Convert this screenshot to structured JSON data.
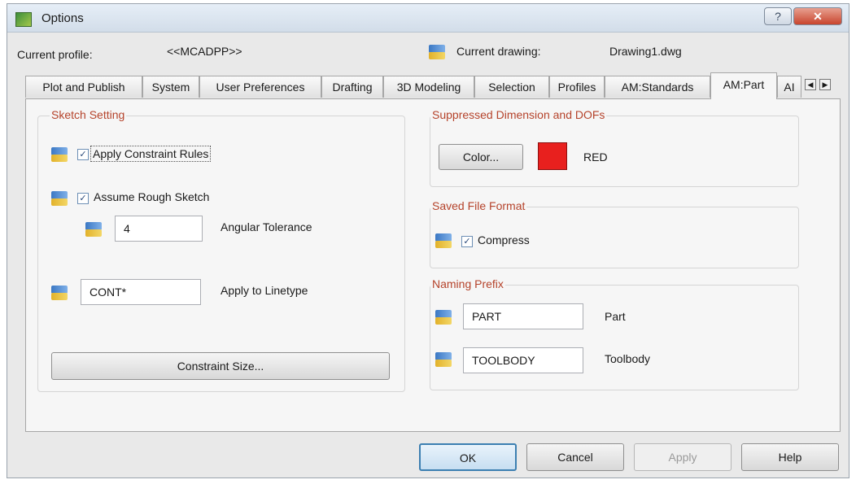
{
  "window": {
    "title": "Options",
    "help_glyph": "?",
    "close_glyph": "✕"
  },
  "profile": {
    "label": "Current profile:",
    "value": "<<MCADPP>>"
  },
  "drawing": {
    "label": "Current drawing:",
    "value": "Drawing1.dwg"
  },
  "tabs": [
    "Plot and Publish",
    "System",
    "User Preferences",
    "Drafting",
    "3D Modeling",
    "Selection",
    "Profiles",
    "AM:Standards",
    "AM:Part",
    "AI"
  ],
  "tab_scroll": {
    "left": "◀",
    "right": "▶"
  },
  "sketch": {
    "title": "Sketch Setting",
    "apply_constraint": "Apply Constraint Rules",
    "assume_rough": "Assume Rough Sketch",
    "angular_value": "4",
    "angular_label": "Angular Tolerance",
    "linetype_value": "CONT*",
    "linetype_label": "Apply to Linetype",
    "constraint_size": "Constraint Size..."
  },
  "suppressed": {
    "title": "Suppressed Dimension and DOFs",
    "color_button": "Color...",
    "color_name": "RED",
    "color_hex": "#e8201e"
  },
  "saved": {
    "title": "Saved File Format",
    "compress": "Compress"
  },
  "naming": {
    "title": "Naming Prefix",
    "part_value": "PART",
    "part_label": "Part",
    "toolbody_value": "TOOLBODY",
    "toolbody_label": "Toolbody"
  },
  "buttons": {
    "ok": "OK",
    "cancel": "Cancel",
    "apply": "Apply",
    "help": "Help"
  },
  "check_mark": "✓"
}
